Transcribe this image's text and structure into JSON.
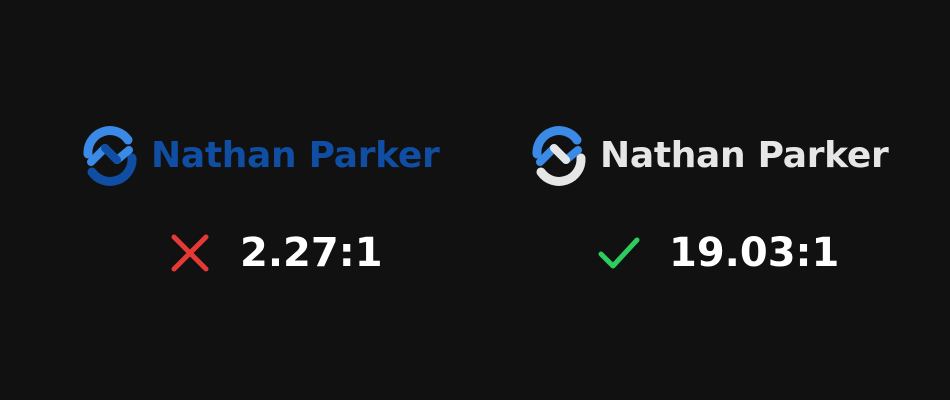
{
  "examples": [
    {
      "brand_name": "Nathan Parker",
      "ratio": "2.27:1",
      "status_icon": "cross-icon",
      "colors": {
        "text": "#0f4ea3",
        "mark_primary": "#3a8ae6",
        "mark_secondary": "#0f4ea3",
        "status": "#e53935"
      }
    },
    {
      "brand_name": "Nathan Parker",
      "ratio": "19.03:1",
      "status_icon": "check-icon",
      "colors": {
        "text": "#e6e6e6",
        "mark_primary": "#3a8ae6",
        "mark_secondary": "#e6e6e6",
        "status": "#2ecc5f"
      }
    }
  ]
}
